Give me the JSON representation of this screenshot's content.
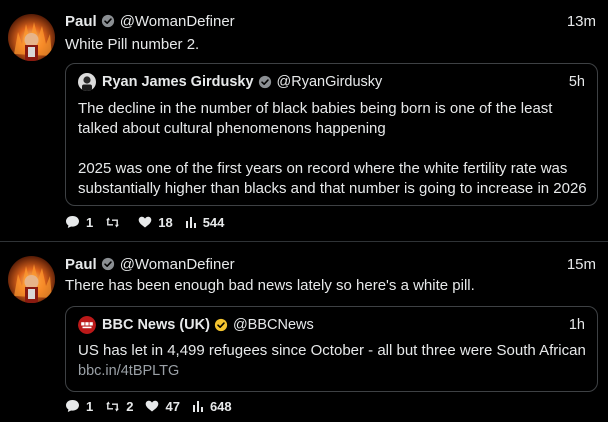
{
  "tweets": [
    {
      "author": {
        "name": "Paul",
        "handle": "@WomanDefiner",
        "verified": true
      },
      "time": "13m",
      "text": "White Pill number 2.",
      "quote": {
        "author": {
          "name": "Ryan James Girdusky",
          "handle": "@RyanGirdusky",
          "verified": true
        },
        "time": "5h",
        "paragraphs": [
          "The decline in the number of black babies being born is one of the least talked about cultural phenomenons happening",
          "2025 was one of the first years on record where the white fertility rate was substantially higher than blacks and that number is going to increase in 2026"
        ]
      },
      "stats": {
        "replies": "1",
        "retweets": "",
        "likes": "18",
        "views": "544"
      }
    },
    {
      "author": {
        "name": "Paul",
        "handle": "@WomanDefiner",
        "verified": true
      },
      "time": "15m",
      "text": "There has been enough bad news lately so here's a white pill.",
      "quote": {
        "author": {
          "name": "BBC News (UK)",
          "handle": "@BBCNews",
          "verified": true,
          "badge_color": "#f4c430"
        },
        "time": "1h",
        "paragraphs": [
          "US has let in 4,499 refugees since October - all but three were South African"
        ],
        "link": "bbc.in/4tBPLTG"
      },
      "stats": {
        "replies": "1",
        "retweets": "2",
        "likes": "47",
        "views": "648"
      }
    }
  ],
  "icons": {
    "reply": "speech-bubble-icon",
    "retweet": "retweet-icon",
    "like": "heart-icon",
    "views": "bar-chart-icon",
    "verified": "verified-badge-icon"
  },
  "colors": {
    "background": "#000000",
    "text": "#e7e9ea",
    "border": "#3e4144",
    "divider": "#2f3336",
    "verified_gray": "#8b8f93",
    "verified_gold": "#f4c430"
  }
}
